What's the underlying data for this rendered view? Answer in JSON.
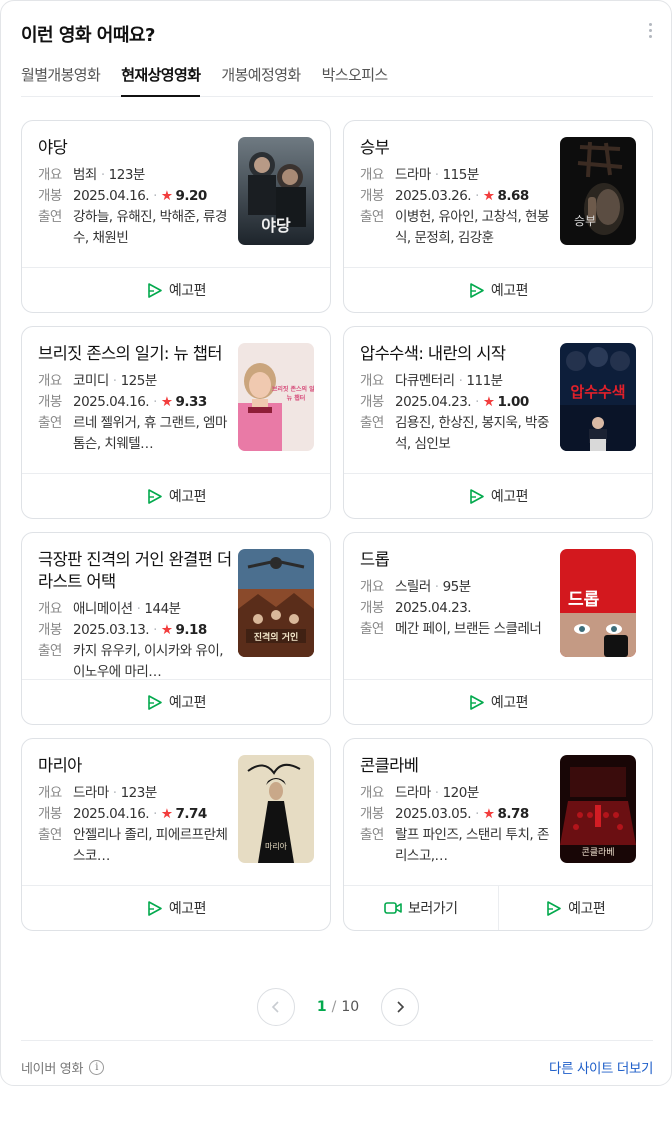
{
  "header": {
    "title": "이런 영화 어때요?"
  },
  "tabs": [
    "월별개봉영화",
    "현재상영영화",
    "개봉예정영화",
    "박스오피스"
  ],
  "labels": {
    "overview": "개요",
    "release": "개봉",
    "cast": "출연",
    "trailer": "예고편",
    "watch": "보러가기"
  },
  "colors": {
    "accent_green": "#03a94d",
    "star_red": "#f23d3d",
    "link_blue": "#1f5fc9"
  },
  "movies": [
    {
      "title": "야당",
      "genre": "범죄",
      "runtime": "123분",
      "date": "2025.04.16.",
      "rating": "9.20",
      "cast": "강하늘, 유해진, 박해준, 류경수, 채원빈",
      "poster": "poster-yadang"
    },
    {
      "title": "승부",
      "genre": "드라마",
      "runtime": "115분",
      "date": "2025.03.26.",
      "rating": "8.68",
      "cast": "이병헌, 유아인, 고창석, 현봉식, 문정희, 김강훈",
      "poster": "poster-seungbu"
    },
    {
      "title": "브리짓 존스의 일기: 뉴 챕터",
      "genre": "코미디",
      "runtime": "125분",
      "date": "2025.04.16.",
      "rating": "9.33",
      "cast": "르네 젤위거, 휴 그랜트, 엠마 톰슨, 치웨텔…",
      "poster": "poster-bridget"
    },
    {
      "title": "압수수색: 내란의 시작",
      "genre": "다큐멘터리",
      "runtime": "111분",
      "date": "2025.04.23.",
      "rating": "1.00",
      "cast": "김용진, 한상진, 봉지욱, 박중석, 심인보",
      "poster": "poster-apsu"
    },
    {
      "title": "극장판 진격의 거인 완결편 더 라스트 어택",
      "genre": "애니메이션",
      "runtime": "144분",
      "date": "2025.03.13.",
      "rating": "9.18",
      "cast": "카지 유우키, 이시카와 유이, 이노우에 마리…",
      "poster": "poster-titan"
    },
    {
      "title": "드롭",
      "genre": "스릴러",
      "runtime": "95분",
      "date": "2025.04.23.",
      "rating": "",
      "cast": "메간 페이, 브랜든 스클레너",
      "poster": "poster-drop"
    },
    {
      "title": "마리아",
      "genre": "드라마",
      "runtime": "123분",
      "date": "2025.04.16.",
      "rating": "7.74",
      "cast": "안젤리나 졸리, 피에르프란체스코…",
      "poster": "poster-maria"
    },
    {
      "title": "콘클라베",
      "genre": "드라마",
      "runtime": "120분",
      "date": "2025.03.05.",
      "rating": "8.78",
      "cast": "랄프 파인즈, 스탠리 투치, 존 리스고,…",
      "poster": "poster-conclave"
    }
  ],
  "poster_text": {
    "yadang": "야당",
    "seungbu": "승부",
    "bridget": "브리짓 존스의 일기",
    "bridget_sub": "뉴 챕터",
    "apsu": "압수수색",
    "titan": "진격의 거인",
    "drop": "드롭",
    "maria": "마리아",
    "conclave": "콘클라베"
  },
  "pagination": {
    "current": "1",
    "separator": "/",
    "total": "10"
  },
  "footer": {
    "source": "네이버 영화",
    "info_glyph": "i",
    "more_link": "다른 사이트 더보기"
  }
}
